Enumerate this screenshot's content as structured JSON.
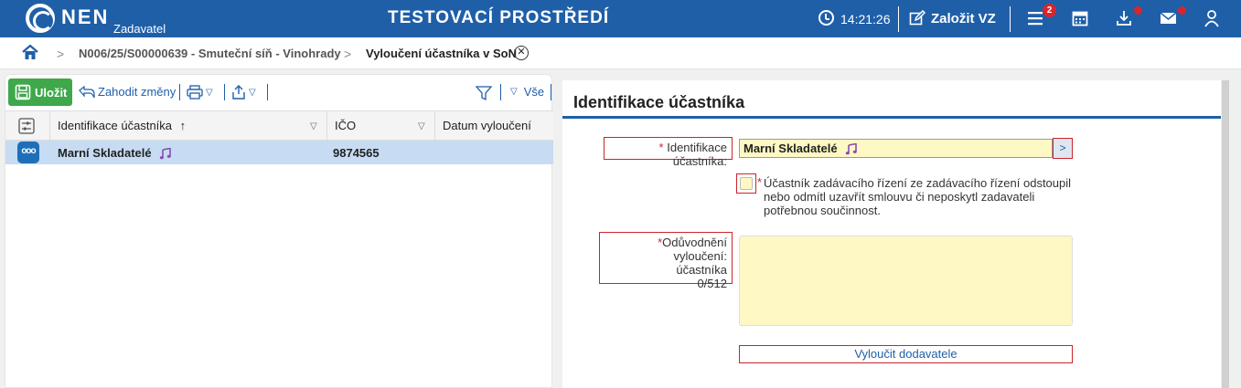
{
  "header": {
    "logo_text": "NEN",
    "logo_sub": "Zadavatel",
    "environment": "TESTOVACÍ PROSTŘEDÍ",
    "time": "14:21:26",
    "create_label": "Založit VZ",
    "menu_badge": "2",
    "icons": [
      "clock-icon",
      "edit-icon",
      "menu-icon",
      "calendar-icon",
      "download-icon",
      "mail-icon",
      "user-icon"
    ]
  },
  "breadcrumb": {
    "items": [
      "N006/25/S00000639 - Smuteční síň - Vinohrady",
      "Vyloučení účastníka v SoN"
    ]
  },
  "toolbar": {
    "save_label": "Uložit",
    "discard_label": "Zahodit změny",
    "filter_label": "Vše"
  },
  "grid": {
    "columns": [
      "Identifikace účastníka",
      "IČO",
      "Datum vyloučení"
    ],
    "rows": [
      {
        "name": "Marní Skladatelé",
        "ico": "9874565",
        "date": ""
      }
    ]
  },
  "form": {
    "title": "Identifikace účastníka",
    "participant_label": "Identifikace účastníka:",
    "participant_value": "Marní Skladatelé",
    "checkbox_text": "Účastník zadávacího řízení ze zadávacího řízení odstoupil nebo odmítl uzavřít smlouvu či neposkytl zadavateli potřebnou součinnost.",
    "reason_label_1": "Odůvodnění vyloučení:",
    "reason_label_2": "účastníka",
    "reason_counter": "0/512",
    "reason_value": "",
    "exclude_button": "Vyloučit dodavatele",
    "required_mark": "*"
  },
  "colors": {
    "header_bg": "#1f5fa8",
    "save_green": "#3ea84b",
    "required_red": "#c9252b",
    "input_yellow": "#fdf8c4",
    "selected_row": "#c7dcf3"
  }
}
